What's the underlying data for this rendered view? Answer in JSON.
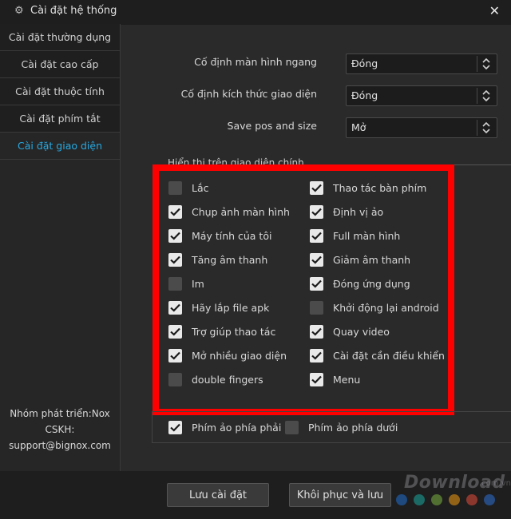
{
  "window": {
    "title": "Cài đặt hệ thống"
  },
  "sidebar": {
    "items": [
      {
        "label": "Cài đặt thường dụng",
        "active": false
      },
      {
        "label": "Cài đặt cao cấp",
        "active": false
      },
      {
        "label": "Cài đặt thuộc tính",
        "active": false
      },
      {
        "label": "Cài đặt phím tắt",
        "active": false
      },
      {
        "label": "Cài đặt giao diện",
        "active": true
      }
    ],
    "info": {
      "dev_team": "Nhóm phát triển:Nox",
      "cskh_label": "CSKH:",
      "email": "support@bignox.com"
    }
  },
  "settings": [
    {
      "label": "Cố định màn hình ngang",
      "value": "Đóng"
    },
    {
      "label": "Cố định kích thức giao diện",
      "value": "Đóng"
    },
    {
      "label": "Save pos and size",
      "value": "Mở"
    }
  ],
  "group": {
    "label": "Hiển thị trên giao diện chính"
  },
  "checkboxes": {
    "left": [
      {
        "label": "Lắc",
        "checked": false
      },
      {
        "label": "Chụp ảnh màn hình",
        "checked": true
      },
      {
        "label": "Máy tính của tôi",
        "checked": true
      },
      {
        "label": "Tăng âm thanh",
        "checked": true
      },
      {
        "label": "Im",
        "checked": false
      },
      {
        "label": "Hãy lắp file apk",
        "checked": true
      },
      {
        "label": "Trợ giúp thao tác",
        "checked": true
      },
      {
        "label": "Mở nhiều giao diện",
        "checked": true
      },
      {
        "label": "double fingers",
        "checked": false
      }
    ],
    "right": [
      {
        "label": "Thao tác bàn phím",
        "checked": true
      },
      {
        "label": "Định vị ảo",
        "checked": true
      },
      {
        "label": "Full màn hình",
        "checked": true
      },
      {
        "label": "Giảm âm thanh",
        "checked": true
      },
      {
        "label": "Đóng ứng dụng",
        "checked": true
      },
      {
        "label": "Khởi động lại android",
        "checked": false
      },
      {
        "label": "Quay video",
        "checked": true
      },
      {
        "label": "Cài đặt cần điều khiển",
        "checked": true
      },
      {
        "label": "Menu",
        "checked": true
      }
    ]
  },
  "bottom_options": [
    {
      "label": "Phím ảo phía phải",
      "checked": true
    },
    {
      "label": "Phím ảo phía dưới",
      "checked": false
    }
  ],
  "buttons": {
    "save": "Lưu cài đặt",
    "restore": "Khôi phục và lưu"
  },
  "watermark": {
    "brand": "Download",
    "domain": ".com.vn",
    "dot_colors": [
      "#1f6fd1",
      "#19a9a0",
      "#7cb342",
      "#f39c12",
      "#e74c3c",
      "#2d6fd6"
    ]
  },
  "colors": {
    "accent": "#27a9e1",
    "highlight_border": "#ff0000",
    "background": "#262626"
  }
}
